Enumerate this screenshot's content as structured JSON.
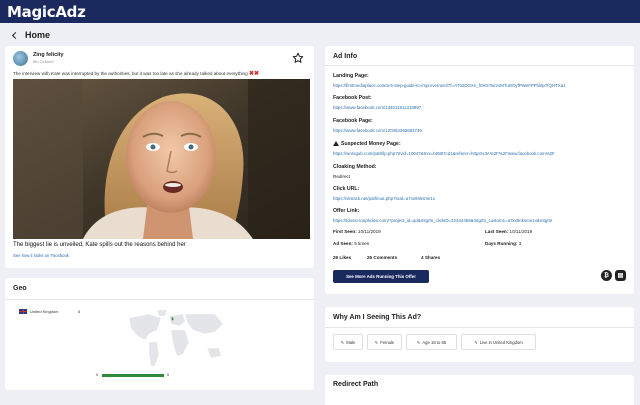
{
  "app": {
    "title": "MagicAdz"
  },
  "nav": {
    "back_label": "Home"
  },
  "post": {
    "page_name": "Zing felicity",
    "date": "8th October",
    "text": "The interview with Kate was interrupted by the authorities, but it was too late as she already talked about everything",
    "text_marks": "✖✖",
    "title": "The biggest lie is unveiled, Kate spills out the reasons behind her",
    "facebook_link": "See how it looks on Facebook"
  },
  "geo": {
    "title": "Geo",
    "rows": [
      {
        "country": "United Kingdom",
        "count": "5"
      }
    ],
    "bar": {
      "min": "5",
      "max": "5",
      "fill": 1.0
    }
  },
  "ad_info": {
    "title": "Ad Info",
    "landing_page": {
      "label": "Landing Page:",
      "value": "https://firstmediaplace.com/a-5-step-guide-to-improvement/?f=AT02DGXn_fOK5TwrzsMTuDOyfPWeFPFhi0p7fQHTXa1"
    },
    "facebook_post": {
      "label": "Facebook Post:",
      "value": "https://www.facebook.com/134011911318897"
    },
    "facebook_page": {
      "label": "Facebook Page:",
      "value": "https://www.facebook.com/120363392682749"
    },
    "money_page": {
      "label": "Suspected Money Page:",
      "value": "https://worsgub.com/path/lp.php?trvid=10047&trvx=b0887cd1&referer=https%3A%2F%2Fwww.facebook.com%2F"
    },
    "cloaking": {
      "label": "Cloaking Method:",
      "value": "Redirect"
    },
    "click_url": {
      "label": "Click URL:",
      "value": "https://vktrack.net/path/out.php?sxid=a7xx9nksme1v"
    },
    "offer_link": {
      "label": "Offer Link:",
      "value": "https://tdosin-loopholes.com/?project_id=qd&mtgrtn_clickID=22344455&mtgrtn_custom1=a7xx9nksme1v&mtgrtn"
    },
    "first_seen": {
      "label": "First Seen:",
      "value": "10/11/2019"
    },
    "last_seen": {
      "label": "Last Seen:",
      "value": "10/11/2019"
    },
    "ad_seen": {
      "label": "Ad Seen:",
      "value": "5 times"
    },
    "days_running": {
      "label": "Days Running:",
      "value": "3"
    },
    "likes": "29 Likes",
    "comments": "26 Comments",
    "shares": "4 Shares",
    "offer_button": "See More Ads Running This Offer",
    "icon_colors": {
      "warn": "#222222",
      "circle": "#222222"
    }
  },
  "why": {
    "title": "Why Am I Seeing This Ad?",
    "chips": [
      {
        "label": "Male"
      },
      {
        "label": "Female"
      },
      {
        "label": "Age 18 to 65"
      },
      {
        "label": "Live in United Kingdom"
      }
    ]
  },
  "redirect": {
    "title": "Redirect Path"
  },
  "colors": {
    "brand": "#1b2a5e",
    "link": "#2a6fb0",
    "bar": "#2e8b3a",
    "flag_x": "#d0312d"
  }
}
